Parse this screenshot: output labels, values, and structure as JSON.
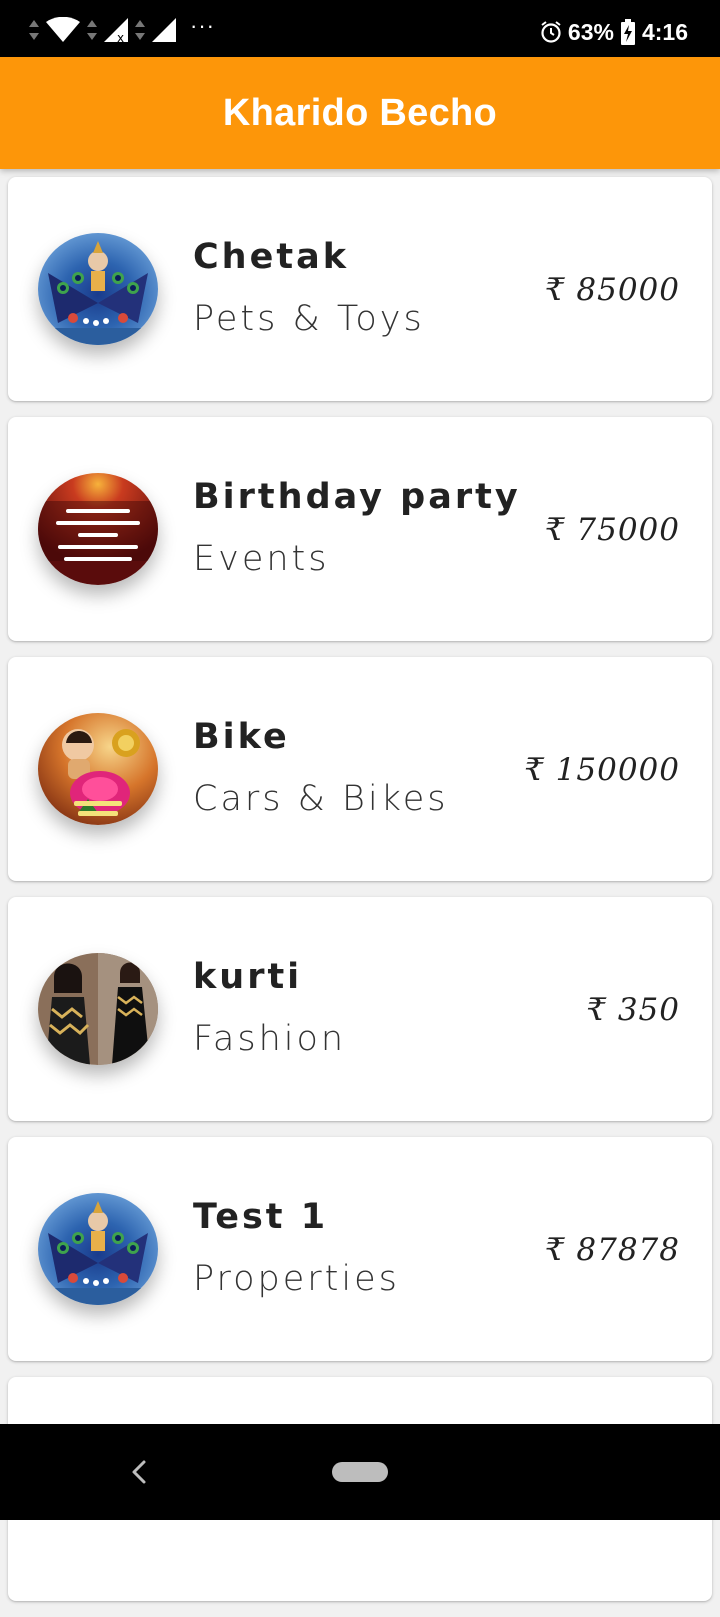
{
  "status_bar": {
    "battery": "63%",
    "time": "4:16",
    "more": "···",
    "icons": [
      "wifi-icon",
      "signal-icon",
      "signal-2-icon",
      "alarm-icon",
      "battery-icon"
    ]
  },
  "app_bar": {
    "title": "Kharido Becho",
    "color": "#fd9609"
  },
  "items": [
    {
      "title": "Chetak",
      "category": "Pets & Toys",
      "price": "₹ 85000",
      "thumbnail": "peacock-krishna-image"
    },
    {
      "title": "Birthday party",
      "category": "Events",
      "price": "₹ 75000",
      "thumbnail": "quote-roses-image"
    },
    {
      "title": "Bike",
      "category": "Cars & Bikes",
      "price": "₹ 150000",
      "thumbnail": "good-morning-rose-image"
    },
    {
      "title": "kurti",
      "category": "Fashion",
      "price": "₹ 350",
      "thumbnail": "fashion-kurti-image"
    },
    {
      "title": "Test 1",
      "category": "Properties",
      "price": "₹ 87878",
      "thumbnail": "peacock-krishna-image"
    }
  ],
  "nav_bar": {
    "icons": [
      "back-icon",
      "home-pill-icon"
    ]
  }
}
